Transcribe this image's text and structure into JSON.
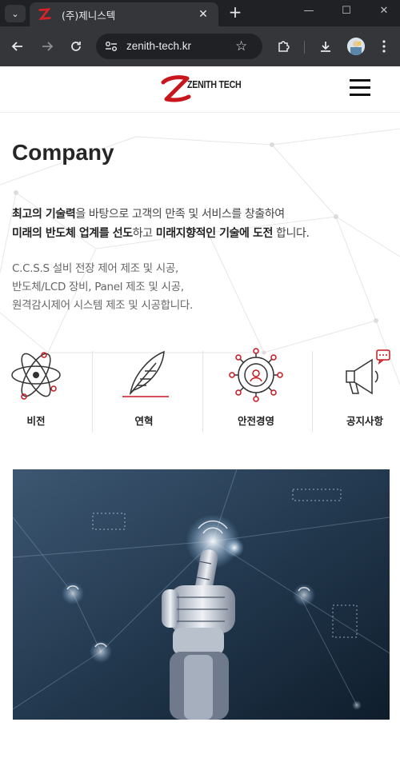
{
  "browser": {
    "tab_title": "(주)제니스텍",
    "url": "zenith-tech.kr",
    "icons": {
      "tab_menu": "chevron-down-icon",
      "tab_close": "close-icon",
      "new_tab": "plus-icon",
      "minimize": "minimize-icon",
      "maximize": "maximize-icon",
      "close": "window-close-icon",
      "back": "back-arrow-icon",
      "forward": "forward-arrow-icon",
      "reload": "reload-icon",
      "site_info": "tune-icon",
      "bookmark": "star-icon",
      "extensions": "puzzle-icon",
      "download": "download-icon",
      "profile": "avatar",
      "more": "kebab-menu-icon"
    }
  },
  "header": {
    "logo_text": "ZENITH TECH",
    "brand_color": "#c8161d"
  },
  "page": {
    "title": "Company",
    "intro": {
      "line1_bold": "최고의 기술력",
      "line1_rest": "을 바탕으로 고객의 만족 및 서비스를 창출하여",
      "line2_bold1": "미래의 반도체 업계를 선도",
      "line2_mid": "하고 ",
      "line2_bold2": "미래지향적인 기술에 도전",
      "line2_rest": " 합니다."
    },
    "desc": [
      "C.C.S.S 설비 전장 제어 제조 및 시공,",
      "반도체/LCD 장비, Panel 제조 및 시공,",
      "원격감시제어 시스템 제조 및 시공합니다."
    ],
    "menu": [
      {
        "label": "비전",
        "icon": "atom-icon"
      },
      {
        "label": "연혁",
        "icon": "feather-icon"
      },
      {
        "label": "안전경영",
        "icon": "safety-gear-icon"
      },
      {
        "label": "공지사항",
        "icon": "megaphone-icon"
      }
    ]
  }
}
